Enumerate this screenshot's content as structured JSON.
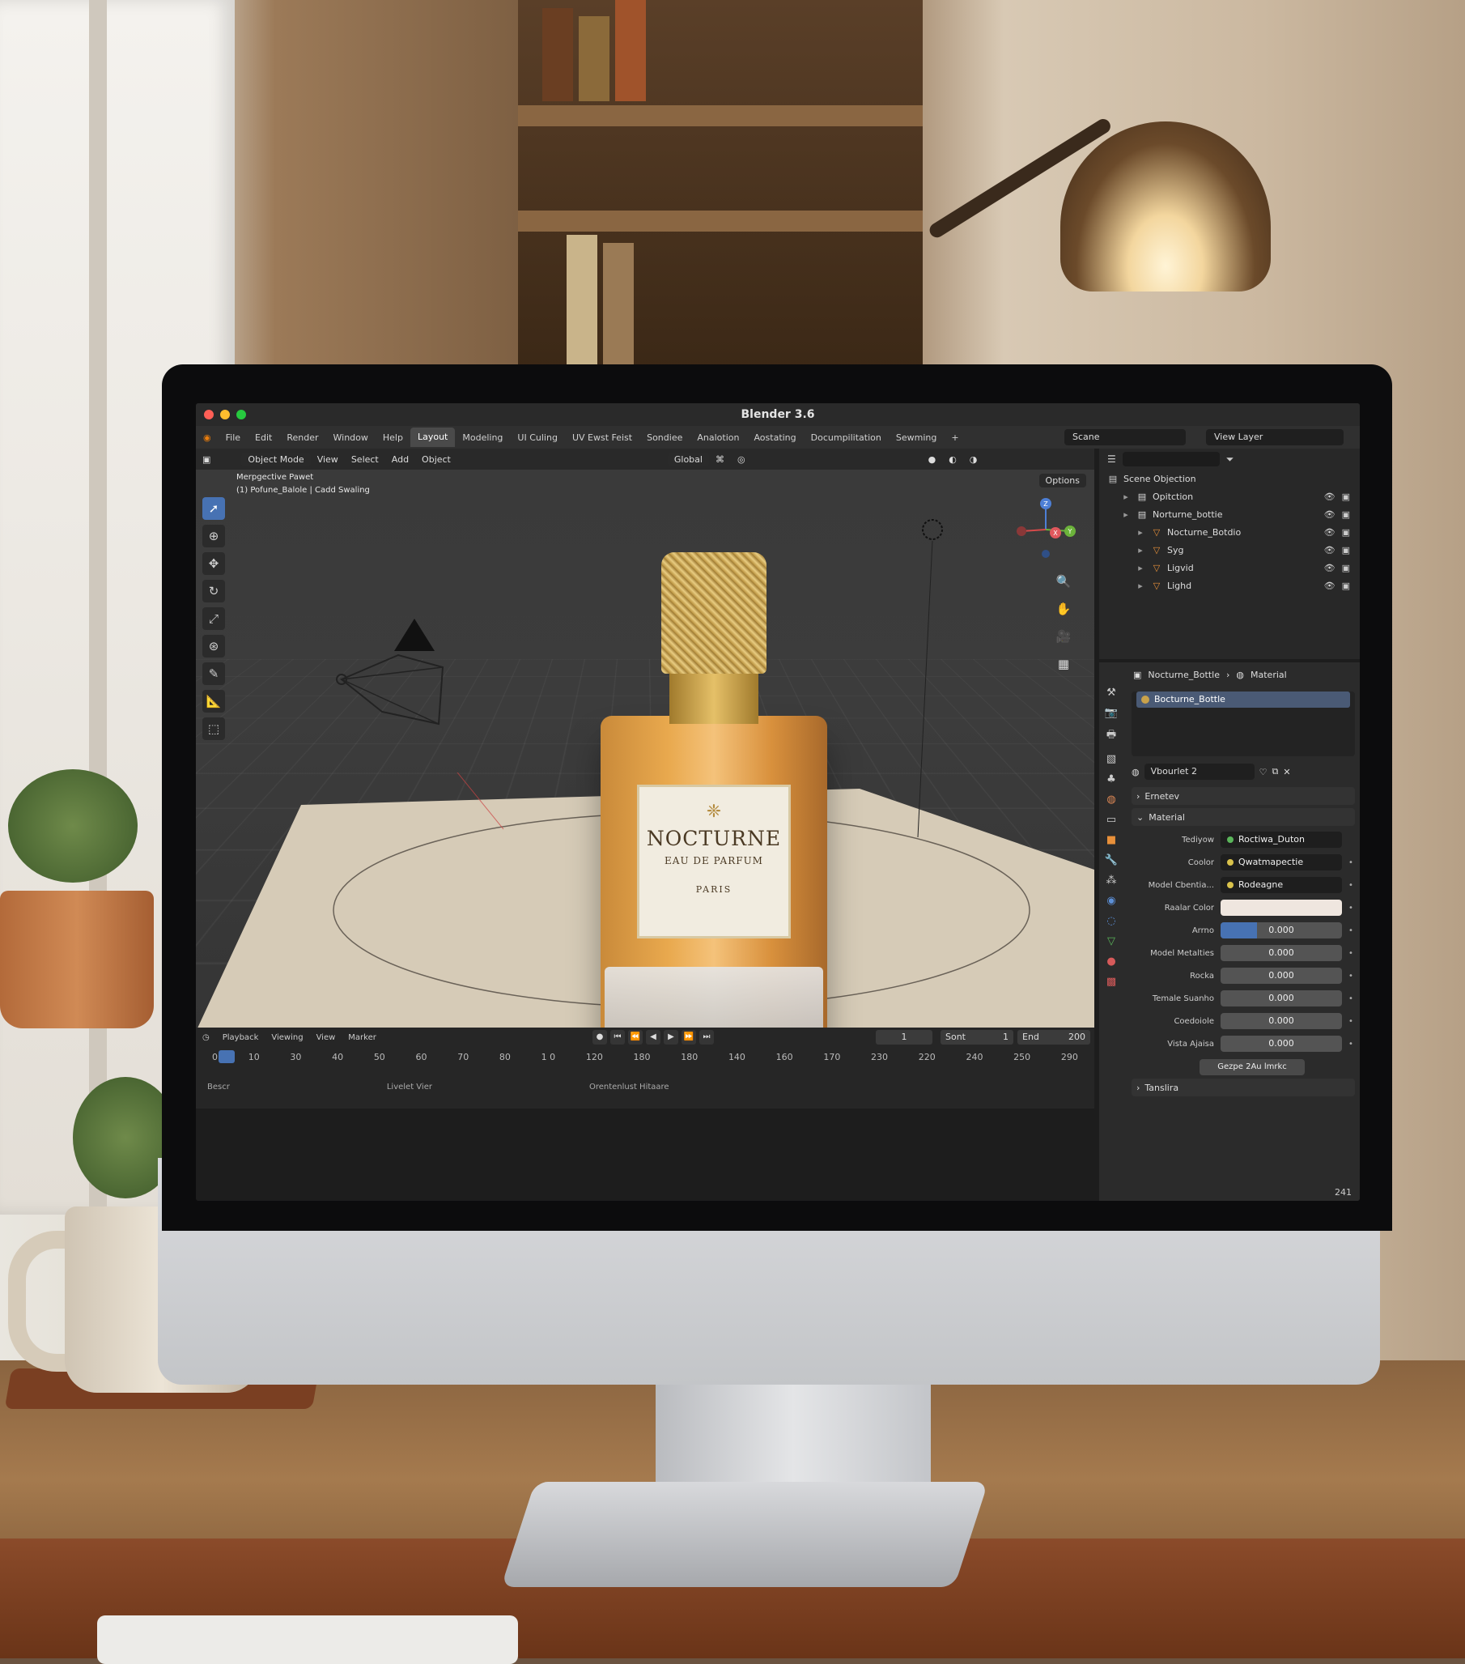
{
  "app": {
    "title": "Blender 3.6",
    "window_controls": {
      "close_color": "#ff5f56",
      "minimize_color": "#ffbd2e",
      "maximize_color": "#27c93f"
    }
  },
  "topbar": {
    "menus": [
      "File",
      "Edit",
      "Render",
      "Window",
      "Help"
    ],
    "workspaces": [
      "Layout",
      "Modeling",
      "UI Culing",
      "UV Ewst Feist",
      "Sondiee",
      "Analotion",
      "Aostating",
      "Documpilitation",
      "Sewming"
    ],
    "active_workspace": "Layout",
    "add_workspace": "+",
    "scene": "Scane",
    "view_layer": "View Layer"
  },
  "viewport": {
    "mode": "Object Mode",
    "menus": [
      "View",
      "Select",
      "Add",
      "Object"
    ],
    "transform_orientation": "Global",
    "options": "Options",
    "info_line1": "Merpgective Pawet",
    "info_line2": "(1) Pofune_Balole | Cadd Swaling",
    "accent_color": "#4772b3",
    "tools": [
      "select-icon",
      "cursor-icon",
      "move-icon",
      "rotate-icon",
      "scale-icon",
      "transform-icon",
      "annotate-icon",
      "measure-icon",
      "add-cube-icon"
    ],
    "gizmo_axes": {
      "x": "X",
      "y": "Y",
      "z": "Z"
    }
  },
  "product": {
    "brand": "NOCTURNE",
    "subtitle": "EAU DE PARFUM",
    "city": "PARIS",
    "emblem": "❈"
  },
  "timeline": {
    "menus": [
      "Playback",
      "Viewing",
      "View",
      "Marker"
    ],
    "ticks": [
      "0",
      "10",
      "30",
      "40",
      "50",
      "60",
      "70",
      "80",
      "1 0",
      "120",
      "180",
      "180",
      "140",
      "160",
      "170",
      "230",
      "220",
      "240",
      "250",
      "290"
    ],
    "current_frame": "1",
    "start_label": "Sont",
    "start_value": "1",
    "end_label": "End",
    "end_value": "200",
    "status_left": "Bescr",
    "status_mid": "Livelet Vier",
    "status_right": "Orentenlust Hitaare"
  },
  "outliner": {
    "title": "Scene Objection",
    "rows": [
      {
        "label": "Opitction",
        "level": 1,
        "icon": "collection-icon"
      },
      {
        "label": "Norturne_bottie",
        "level": 1,
        "icon": "collection-icon"
      },
      {
        "label": "Nocturne_Botdio",
        "level": 2,
        "icon": "mesh-icon"
      },
      {
        "label": "Syg",
        "level": 2,
        "icon": "mesh-icon"
      },
      {
        "label": "Ligvid",
        "level": 2,
        "icon": "mesh-icon"
      },
      {
        "label": "Lighd",
        "level": 2,
        "icon": "mesh-icon"
      }
    ]
  },
  "properties": {
    "breadcrumb_object": "Nocturne_Bottle",
    "breadcrumb_tab": "Material",
    "slot": "Bocturne_Bottle",
    "material_name": "Vbourlet 2",
    "panel_preview": "Ernetev",
    "panel_material": "Material",
    "surface_label": "Tediyow",
    "surface_value": "Roctiwa_Duton",
    "fields": [
      {
        "label": "Coolor",
        "value": "Qwatmapectie",
        "kind": "link"
      },
      {
        "label": "Model Cbentia...",
        "value": "Rodeagne",
        "kind": "link"
      },
      {
        "label": "Raalar Color",
        "value": "",
        "kind": "color"
      },
      {
        "label": "Arrno",
        "value": "0.000",
        "kind": "num",
        "fill": 0.3
      },
      {
        "label": "Model Metalties",
        "value": "0.000",
        "kind": "num",
        "fill": 0
      },
      {
        "label": "Rocka",
        "value": "0.000",
        "kind": "num",
        "fill": 0
      },
      {
        "label": "Temale Suanho",
        "value": "0.000",
        "kind": "num",
        "fill": 0
      },
      {
        "label": "Coedoiole",
        "value": "0.000",
        "kind": "num",
        "fill": 0
      },
      {
        "label": "Vista Ajaisa",
        "value": "0.000",
        "kind": "num",
        "fill": 0
      }
    ],
    "button": "Gezpe 2Au lmrkc",
    "panel_next": "Tanslira",
    "frame_count": "241"
  }
}
